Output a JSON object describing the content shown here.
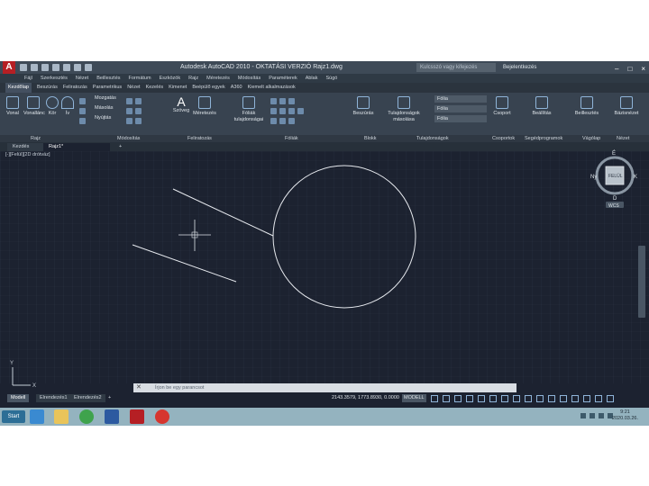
{
  "title_bar": {
    "app_logo": "A",
    "title": "Autodesk AutoCAD 2010 - OKTATÁSI VERZIÓ    Rajz1.dwg",
    "search_placeholder": "Kulcsszó vagy kifejezés",
    "signin": "Bejelentkezés",
    "buttons": [
      "–",
      "□",
      "×"
    ]
  },
  "menu_bar": [
    "Fájl",
    "Szerkesztés",
    "Nézet",
    "Beillesztés",
    "Formátum",
    "Eszközök",
    "Rajz",
    "Méretezés",
    "Módosítás",
    "Paraméterek",
    "Ablak",
    "Súgó"
  ],
  "ribbon_tabs": [
    "Kezdőlap",
    "Beszúrás",
    "Feliratozás",
    "Parametrikus",
    "Nézet",
    "Kezelés",
    "Kimenet",
    "Beépülő egyek",
    "A360",
    "Kiemelt alkalmazások"
  ],
  "ribbon": {
    "draw_tools": [
      "Vonal",
      "Vonallánc",
      "Kör",
      "Ív"
    ],
    "modify_tools": [
      "Mozgatás",
      "Másolás",
      "Nyújtás"
    ],
    "annotation_tools": [
      "Szöveg",
      "Méretezés"
    ],
    "layers_tool": "Fóliák tulajdonságai",
    "layer_value": "Fólia",
    "block_tool": "Beszúrás",
    "properties_tool": "Tulajdonságok másolása",
    "group_tool": "Csoport",
    "utilities_tool": "Beállítás",
    "clipboard_tool": "Beillesztés",
    "view_tool": "Bázisnézet"
  },
  "ribbon_panels": [
    "Rajz",
    "Módosítás",
    "Feliratozás",
    "Fóliák",
    "Blokk",
    "Tulajdonságok",
    "Csoportok",
    "Segédprogramok",
    "Vágólap",
    "Nézet"
  ],
  "file_tabs": [
    "Kezdés",
    "Rajz1*"
  ],
  "viewport_label": "[-][Felül][2D drótváz]",
  "viewcube": {
    "north": "É",
    "south": "D",
    "west": "Ny",
    "east": "K",
    "face": "FELÜL",
    "wcs": "WCS"
  },
  "ucs": {
    "y": "Y",
    "x": "X"
  },
  "command_line": {
    "close": "✕",
    "prompt": "Írjon be egy parancsot"
  },
  "layout_tabs": [
    "Modell",
    "Elrendezés1",
    "Elrendezés2",
    "+"
  ],
  "status_bar": {
    "coordinates": "2143.3579, 1773.8930, 0.0000",
    "model": "MODELL"
  },
  "taskbar": {
    "start": "Start",
    "time": "9:21",
    "date": "2020.03.26."
  },
  "colors": {
    "accent_red": "#b51f24",
    "canvas": "#1c2230",
    "ribbon": "#384350",
    "taskbar": "#94b3bf"
  }
}
